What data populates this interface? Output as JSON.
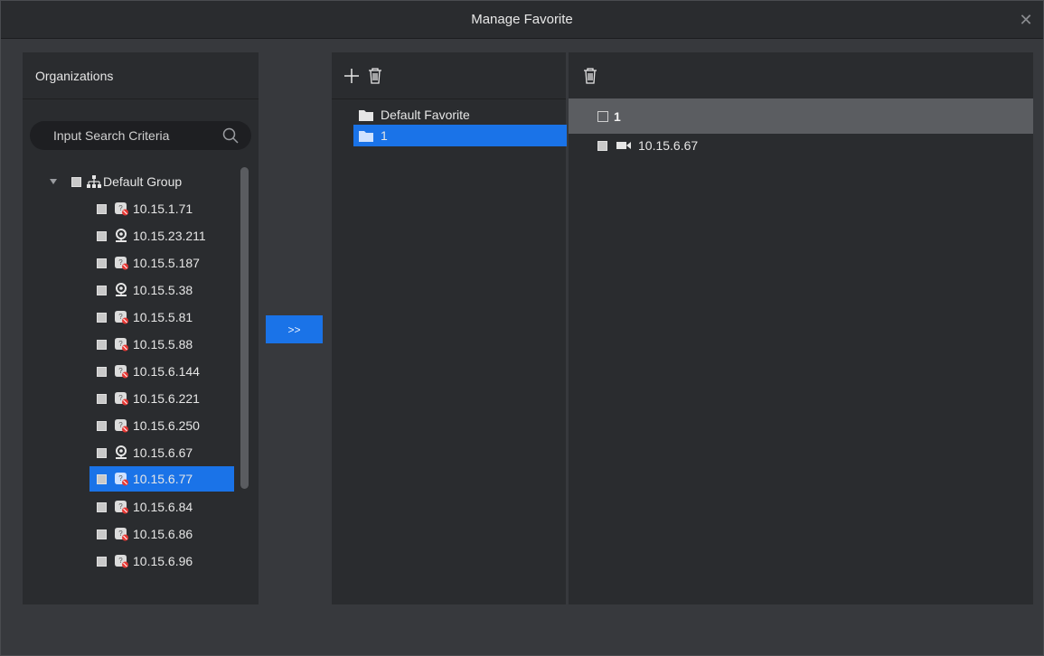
{
  "dialog": {
    "title": "Manage Favorite",
    "close_icon": "close-icon"
  },
  "organizations": {
    "header": "Organizations",
    "search": {
      "placeholder": "Input Search Criteria",
      "value": ""
    },
    "root": {
      "label": "Default Group",
      "expanded": true,
      "icon": "org-tree-icon"
    },
    "devices": [
      {
        "label": "10.15.1.71",
        "icon": "camera-offline-icon"
      },
      {
        "label": "10.15.23.211",
        "icon": "webcam-icon"
      },
      {
        "label": "10.15.5.187",
        "icon": "camera-offline-icon"
      },
      {
        "label": "10.15.5.38",
        "icon": "webcam-icon"
      },
      {
        "label": "10.15.5.81",
        "icon": "camera-offline-icon"
      },
      {
        "label": "10.15.5.88",
        "icon": "camera-offline-icon"
      },
      {
        "label": "10.15.6.144",
        "icon": "camera-offline-icon"
      },
      {
        "label": "10.15.6.221",
        "icon": "camera-offline-icon"
      },
      {
        "label": "10.15.6.250",
        "icon": "camera-offline-icon"
      },
      {
        "label": "10.15.6.67",
        "icon": "webcam-icon"
      },
      {
        "label": "10.15.6.77",
        "icon": "camera-offline-icon",
        "selected": true
      },
      {
        "label": "10.15.6.84",
        "icon": "camera-offline-icon"
      },
      {
        "label": "10.15.6.86",
        "icon": "camera-offline-icon"
      },
      {
        "label": "10.15.6.96",
        "icon": "camera-offline-icon"
      }
    ]
  },
  "move_button": {
    "label": ">>"
  },
  "favorites": {
    "toolbar": {
      "add_icon": "plus-icon",
      "delete_icon": "trash-icon"
    },
    "items": [
      {
        "label": "Default Favorite",
        "icon": "folder-icon",
        "selected": false
      },
      {
        "label": "1",
        "icon": "folder-icon",
        "selected": true
      }
    ]
  },
  "favorite_contents": {
    "toolbar": {
      "delete_icon": "trash-icon"
    },
    "group": {
      "label": "1"
    },
    "devices": [
      {
        "label": "10.15.6.67",
        "icon": "video-camera-icon"
      }
    ]
  },
  "colors": {
    "accent": "#1a73e8",
    "panel": "#2a2c2f",
    "background": "#37393d"
  }
}
